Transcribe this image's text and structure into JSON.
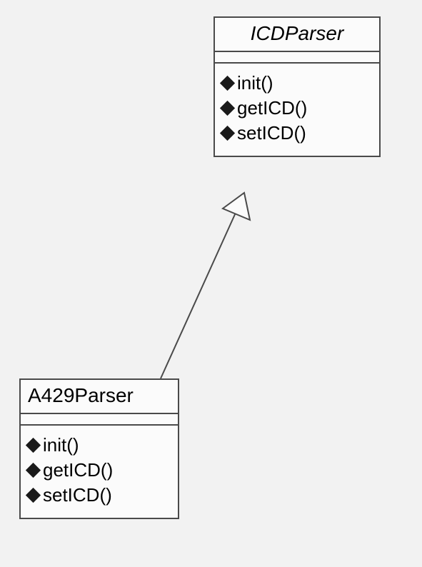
{
  "parent": {
    "name": "ICDParser",
    "ops": [
      "init()",
      "getICD()",
      "setICD()"
    ]
  },
  "child": {
    "name": "A429Parser",
    "ops": [
      "init()",
      "getICD()",
      "setICD()"
    ]
  }
}
